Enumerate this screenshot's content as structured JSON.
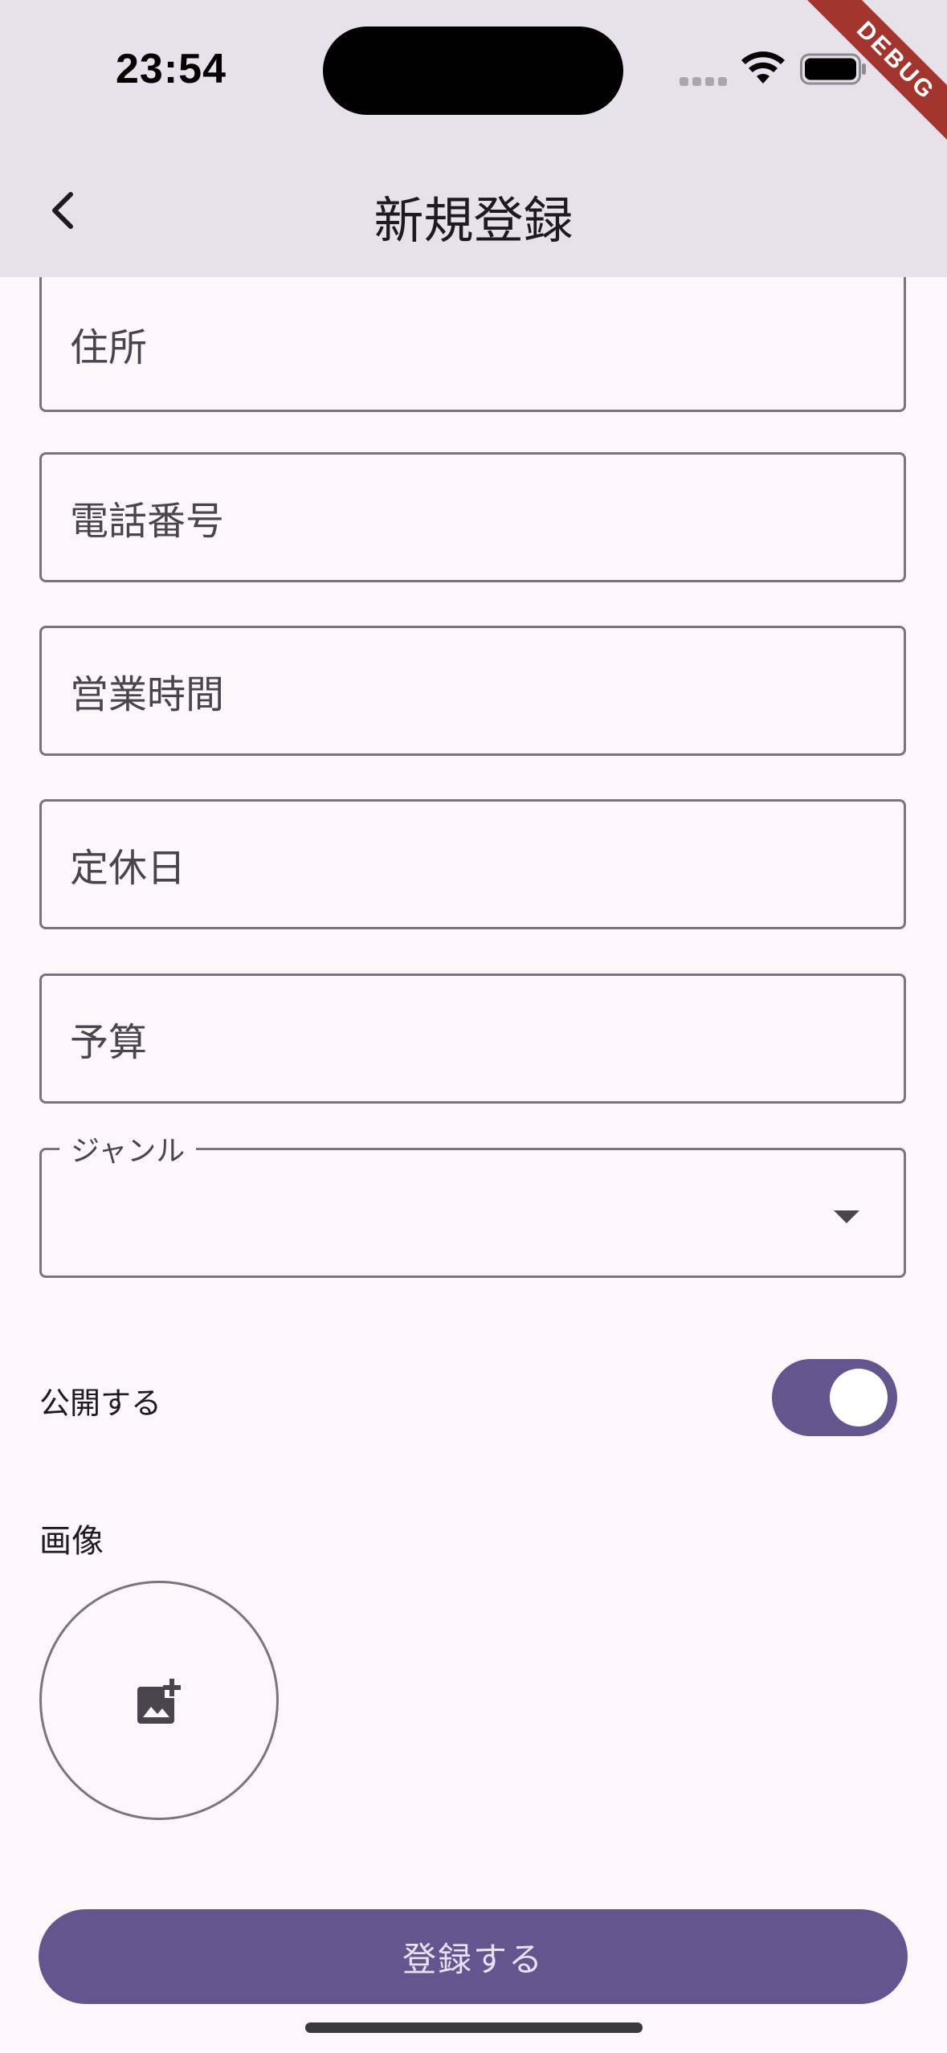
{
  "status_bar": {
    "time": "23:54",
    "icons": [
      "cellular-signal-icon",
      "wifi-icon",
      "battery-icon"
    ]
  },
  "debug_banner": "DEBUG",
  "app_bar": {
    "back_icon": "chevron-left-icon",
    "title": "新規登録"
  },
  "form": {
    "address_placeholder": "住所",
    "phone_placeholder": "電話番号",
    "hours_placeholder": "営業時間",
    "holiday_placeholder": "定休日",
    "budget_placeholder": "予算",
    "genre_label": "ジャンル",
    "genre_value": "",
    "public_label": "公開する",
    "public_enabled": true,
    "image_label": "画像",
    "image_icon": "add-photo-icon",
    "submit_label": "登録する"
  },
  "colors": {
    "primary": "#65558f",
    "surface": "#fdf7fc",
    "app_bar": "#e7e1eb",
    "outline": "#79747e",
    "debug": "#a3352f"
  }
}
